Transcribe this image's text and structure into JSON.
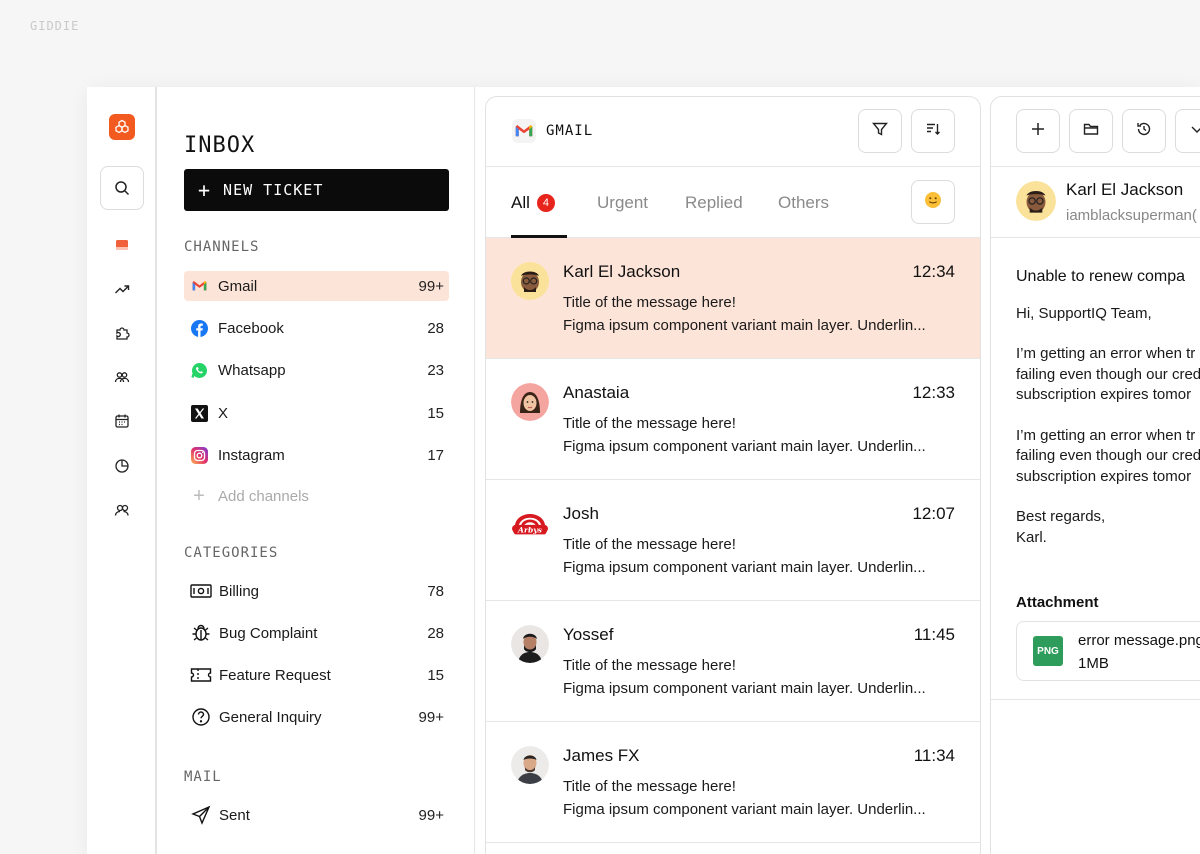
{
  "brand": "GIDDIE",
  "sidebar": {
    "title": "INBOX",
    "new_ticket": "NEW TICKET",
    "channels_label": "CHANNELS",
    "channels": [
      {
        "label": "Gmail",
        "count": "99+",
        "icon": "gmail-icon"
      },
      {
        "label": "Facebook",
        "count": "28",
        "icon": "facebook-icon"
      },
      {
        "label": "Whatsapp",
        "count": "23",
        "icon": "whatsapp-icon"
      },
      {
        "label": "X",
        "count": "15",
        "icon": "x-icon"
      },
      {
        "label": "Instagram",
        "count": "17",
        "icon": "instagram-icon"
      }
    ],
    "add_channels": "Add channels",
    "categories_label": "CATEGORIES",
    "categories": [
      {
        "label": "Billing",
        "count": "78",
        "icon": "money-icon"
      },
      {
        "label": "Bug Complaint",
        "count": "28",
        "icon": "bug-icon"
      },
      {
        "label": "Feature Request",
        "count": "15",
        "icon": "ticket-icon"
      },
      {
        "label": "General Inquiry",
        "count": "99+",
        "icon": "question-icon"
      }
    ],
    "mail_label": "MAIL",
    "mail": [
      {
        "label": "Sent",
        "count": "99+",
        "icon": "send-icon"
      }
    ]
  },
  "list": {
    "title": "GMAIL",
    "tabs": [
      {
        "label": "All",
        "badge": "4"
      },
      {
        "label": "Urgent"
      },
      {
        "label": "Replied"
      },
      {
        "label": "Others"
      }
    ],
    "messages": [
      {
        "name": "Karl El Jackson",
        "time": "12:34",
        "subject": "Title of the message here!",
        "preview": "Figma ipsum component variant main layer. Underlin..."
      },
      {
        "name": "Anastaia",
        "time": "12:33",
        "subject": "Title of the message here!",
        "preview": "Figma ipsum component variant main layer. Underlin..."
      },
      {
        "name": "Josh",
        "time": "12:07",
        "subject": "Title of the message here!",
        "preview": "Figma ipsum component variant main layer. Underlin..."
      },
      {
        "name": "Yossef",
        "time": "11:45",
        "subject": "Title of the message here!",
        "preview": "Figma ipsum component variant main layer. Underlin..."
      },
      {
        "name": "James FX",
        "time": "11:34",
        "subject": "Title of the message here!",
        "preview": "Figma ipsum component variant main layer. Underlin..."
      }
    ]
  },
  "detail": {
    "name": "Karl El Jackson",
    "email": "iamblacksuperman(",
    "subject": "Unable to renew compa",
    "greeting": "Hi, SupportIQ Team,",
    "para1": [
      "I’m getting an error when tr",
      "failing even though our cred",
      "subscription expires tomor"
    ],
    "para2": [
      "I’m getting an error when tr",
      "failing even though our cred",
      "subscription expires tomor"
    ],
    "signoff": [
      "Best regards,",
      "Karl."
    ],
    "attachment_label": "Attachment",
    "file_type": "PNG",
    "file_name": "error message.png",
    "file_size": "1MB"
  }
}
